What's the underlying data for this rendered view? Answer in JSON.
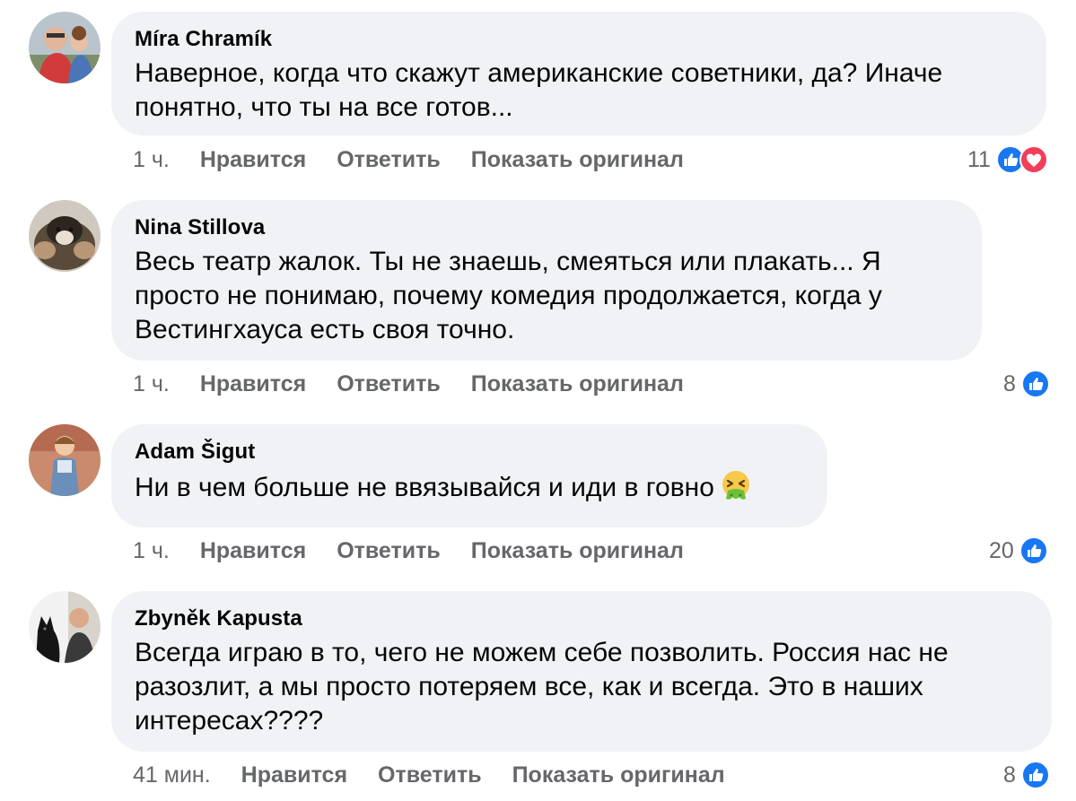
{
  "comments": [
    {
      "author": "Míra Chramík",
      "lines": [
        "Наверное, когда что скажут американские советники, да? Иначе",
        "понятно, что ты на все готов..."
      ],
      "time": "1 ч.",
      "like_label": "Нравится",
      "reply_label": "Ответить",
      "original_label": "Показать оригинал",
      "reaction_count": "11",
      "reactions": [
        "like-icon",
        "love-icon"
      ]
    },
    {
      "author": "Nina Stillova",
      "lines": [
        "Весь театр жалок. Ты не знаешь, смеяться или плакать... Я",
        "просто не понимаю, почему комедия продолжается, когда у",
        "Вестингхауса есть своя точно."
      ],
      "time": "1 ч.",
      "like_label": "Нравится",
      "reply_label": "Ответить",
      "original_label": "Показать оригинал",
      "reaction_count": "8",
      "reactions": [
        "like-icon"
      ]
    },
    {
      "author": "Adam Šigut",
      "lines": [
        "Ни в чем больше не ввязывайся и иди в говно"
      ],
      "emoji": "vomiting-face-emoji",
      "time": "1 ч.",
      "like_label": "Нравится",
      "reply_label": "Ответить",
      "original_label": "Показать оригинал",
      "reaction_count": "20",
      "reactions": [
        "like-icon"
      ]
    },
    {
      "author": "Zbyněk Kapusta",
      "lines": [
        "Всегда играю в то, чего не можем себе позволить. Россия нас не",
        "разозлит, а мы просто потеряем все, как и всегда. Это в наших",
        "интересах????"
      ],
      "time": "41 мин.",
      "like_label": "Нравится",
      "reply_label": "Ответить",
      "original_label": "Показать оригинал",
      "reaction_count": "8",
      "reactions": [
        "like-icon"
      ]
    }
  ],
  "colors": {
    "bubble": "#f0f2f5",
    "text": "#050505",
    "secondary": "#65676b",
    "like": "#1877f2",
    "love": "#f33e58"
  }
}
